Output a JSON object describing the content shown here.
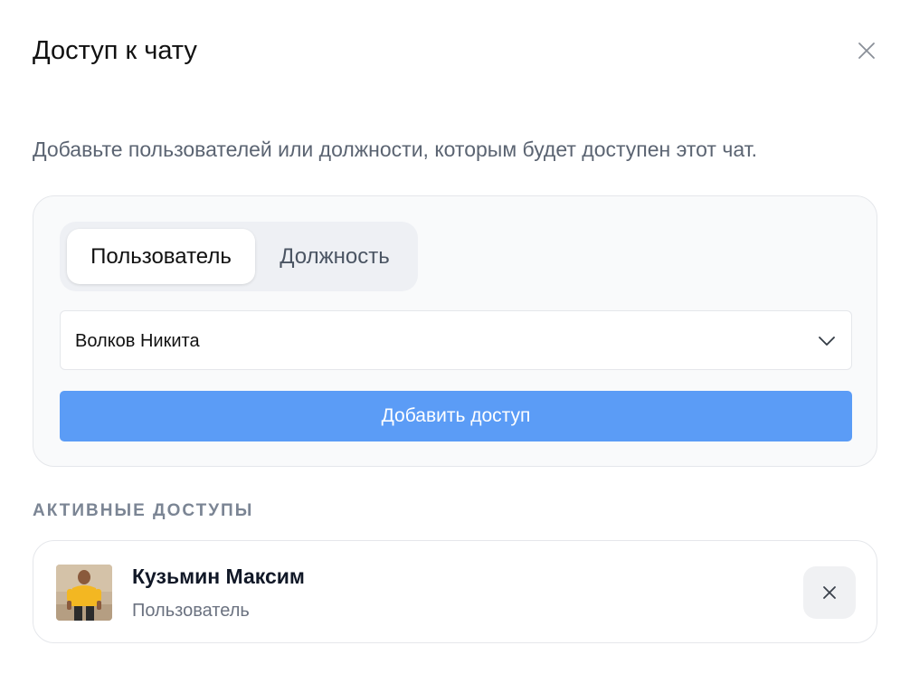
{
  "modal": {
    "title": "Доступ к чату",
    "description": "Добавьте пользователей или должности, которым будет доступен этот чат."
  },
  "tabs": [
    {
      "label": "Пользователь",
      "active": true
    },
    {
      "label": "Должность",
      "active": false
    }
  ],
  "user_select": {
    "value": "Волков Никита"
  },
  "add_button": {
    "label": "Добавить доступ"
  },
  "active_access": {
    "heading": "АКТИВНЫЕ ДОСТУПЫ",
    "items": [
      {
        "name": "Кузьмин Максим",
        "role": "Пользователь",
        "avatar": "user-photo"
      }
    ]
  },
  "icons": {
    "close": "close-icon",
    "chevron": "chevron-down-icon",
    "remove": "close-icon"
  },
  "colors": {
    "primary": "#5b9cf6",
    "muted_text": "#5b6472",
    "section_label": "#7b8594",
    "segment_bg": "#eef0f4"
  }
}
